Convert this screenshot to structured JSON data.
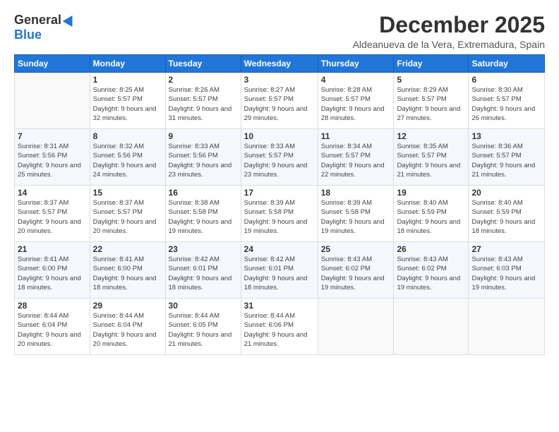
{
  "header": {
    "logo_general": "General",
    "logo_blue": "Blue",
    "month_title": "December 2025",
    "location": "Aldeanueva de la Vera, Extremadura, Spain"
  },
  "weekdays": [
    "Sunday",
    "Monday",
    "Tuesday",
    "Wednesday",
    "Thursday",
    "Friday",
    "Saturday"
  ],
  "weeks": [
    [
      {
        "day": "",
        "sunrise": "",
        "sunset": "",
        "daylight": ""
      },
      {
        "day": "1",
        "sunrise": "Sunrise: 8:25 AM",
        "sunset": "Sunset: 5:57 PM",
        "daylight": "Daylight: 9 hours and 32 minutes."
      },
      {
        "day": "2",
        "sunrise": "Sunrise: 8:26 AM",
        "sunset": "Sunset: 5:57 PM",
        "daylight": "Daylight: 9 hours and 31 minutes."
      },
      {
        "day": "3",
        "sunrise": "Sunrise: 8:27 AM",
        "sunset": "Sunset: 5:57 PM",
        "daylight": "Daylight: 9 hours and 29 minutes."
      },
      {
        "day": "4",
        "sunrise": "Sunrise: 8:28 AM",
        "sunset": "Sunset: 5:57 PM",
        "daylight": "Daylight: 9 hours and 28 minutes."
      },
      {
        "day": "5",
        "sunrise": "Sunrise: 8:29 AM",
        "sunset": "Sunset: 5:57 PM",
        "daylight": "Daylight: 9 hours and 27 minutes."
      },
      {
        "day": "6",
        "sunrise": "Sunrise: 8:30 AM",
        "sunset": "Sunset: 5:57 PM",
        "daylight": "Daylight: 9 hours and 26 minutes."
      }
    ],
    [
      {
        "day": "7",
        "sunrise": "Sunrise: 8:31 AM",
        "sunset": "Sunset: 5:56 PM",
        "daylight": "Daylight: 9 hours and 25 minutes."
      },
      {
        "day": "8",
        "sunrise": "Sunrise: 8:32 AM",
        "sunset": "Sunset: 5:56 PM",
        "daylight": "Daylight: 9 hours and 24 minutes."
      },
      {
        "day": "9",
        "sunrise": "Sunrise: 8:33 AM",
        "sunset": "Sunset: 5:56 PM",
        "daylight": "Daylight: 9 hours and 23 minutes."
      },
      {
        "day": "10",
        "sunrise": "Sunrise: 8:33 AM",
        "sunset": "Sunset: 5:57 PM",
        "daylight": "Daylight: 9 hours and 23 minutes."
      },
      {
        "day": "11",
        "sunrise": "Sunrise: 8:34 AM",
        "sunset": "Sunset: 5:57 PM",
        "daylight": "Daylight: 9 hours and 22 minutes."
      },
      {
        "day": "12",
        "sunrise": "Sunrise: 8:35 AM",
        "sunset": "Sunset: 5:57 PM",
        "daylight": "Daylight: 9 hours and 21 minutes."
      },
      {
        "day": "13",
        "sunrise": "Sunrise: 8:36 AM",
        "sunset": "Sunset: 5:57 PM",
        "daylight": "Daylight: 9 hours and 21 minutes."
      }
    ],
    [
      {
        "day": "14",
        "sunrise": "Sunrise: 8:37 AM",
        "sunset": "Sunset: 5:57 PM",
        "daylight": "Daylight: 9 hours and 20 minutes."
      },
      {
        "day": "15",
        "sunrise": "Sunrise: 8:37 AM",
        "sunset": "Sunset: 5:57 PM",
        "daylight": "Daylight: 9 hours and 20 minutes."
      },
      {
        "day": "16",
        "sunrise": "Sunrise: 8:38 AM",
        "sunset": "Sunset: 5:58 PM",
        "daylight": "Daylight: 9 hours and 19 minutes."
      },
      {
        "day": "17",
        "sunrise": "Sunrise: 8:39 AM",
        "sunset": "Sunset: 5:58 PM",
        "daylight": "Daylight: 9 hours and 19 minutes."
      },
      {
        "day": "18",
        "sunrise": "Sunrise: 8:39 AM",
        "sunset": "Sunset: 5:58 PM",
        "daylight": "Daylight: 9 hours and 19 minutes."
      },
      {
        "day": "19",
        "sunrise": "Sunrise: 8:40 AM",
        "sunset": "Sunset: 5:59 PM",
        "daylight": "Daylight: 9 hours and 18 minutes."
      },
      {
        "day": "20",
        "sunrise": "Sunrise: 8:40 AM",
        "sunset": "Sunset: 5:59 PM",
        "daylight": "Daylight: 9 hours and 18 minutes."
      }
    ],
    [
      {
        "day": "21",
        "sunrise": "Sunrise: 8:41 AM",
        "sunset": "Sunset: 6:00 PM",
        "daylight": "Daylight: 9 hours and 18 minutes."
      },
      {
        "day": "22",
        "sunrise": "Sunrise: 8:41 AM",
        "sunset": "Sunset: 6:00 PM",
        "daylight": "Daylight: 9 hours and 18 minutes."
      },
      {
        "day": "23",
        "sunrise": "Sunrise: 8:42 AM",
        "sunset": "Sunset: 6:01 PM",
        "daylight": "Daylight: 9 hours and 18 minutes."
      },
      {
        "day": "24",
        "sunrise": "Sunrise: 8:42 AM",
        "sunset": "Sunset: 6:01 PM",
        "daylight": "Daylight: 9 hours and 18 minutes."
      },
      {
        "day": "25",
        "sunrise": "Sunrise: 8:43 AM",
        "sunset": "Sunset: 6:02 PM",
        "daylight": "Daylight: 9 hours and 19 minutes."
      },
      {
        "day": "26",
        "sunrise": "Sunrise: 8:43 AM",
        "sunset": "Sunset: 6:02 PM",
        "daylight": "Daylight: 9 hours and 19 minutes."
      },
      {
        "day": "27",
        "sunrise": "Sunrise: 8:43 AM",
        "sunset": "Sunset: 6:03 PM",
        "daylight": "Daylight: 9 hours and 19 minutes."
      }
    ],
    [
      {
        "day": "28",
        "sunrise": "Sunrise: 8:44 AM",
        "sunset": "Sunset: 6:04 PM",
        "daylight": "Daylight: 9 hours and 20 minutes."
      },
      {
        "day": "29",
        "sunrise": "Sunrise: 8:44 AM",
        "sunset": "Sunset: 6:04 PM",
        "daylight": "Daylight: 9 hours and 20 minutes."
      },
      {
        "day": "30",
        "sunrise": "Sunrise: 8:44 AM",
        "sunset": "Sunset: 6:05 PM",
        "daylight": "Daylight: 9 hours and 21 minutes."
      },
      {
        "day": "31",
        "sunrise": "Sunrise: 8:44 AM",
        "sunset": "Sunset: 6:06 PM",
        "daylight": "Daylight: 9 hours and 21 minutes."
      },
      {
        "day": "",
        "sunrise": "",
        "sunset": "",
        "daylight": ""
      },
      {
        "day": "",
        "sunrise": "",
        "sunset": "",
        "daylight": ""
      },
      {
        "day": "",
        "sunrise": "",
        "sunset": "",
        "daylight": ""
      }
    ]
  ]
}
